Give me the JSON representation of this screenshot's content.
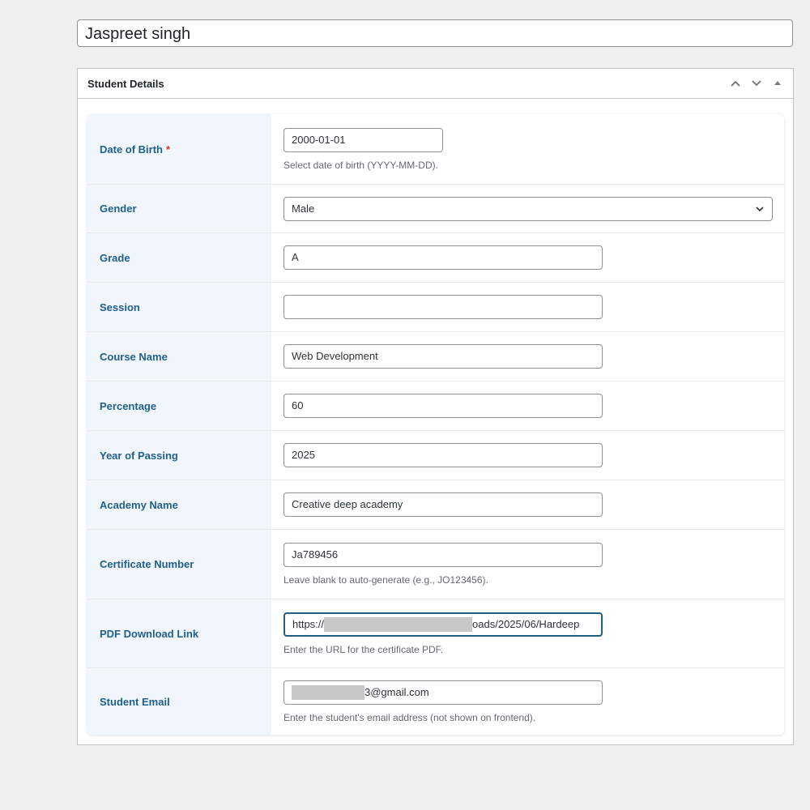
{
  "post_title": "Jaspreet singh",
  "metabox": {
    "title": "Student Details"
  },
  "fields": {
    "dob": {
      "label": "Date of Birth",
      "required_mark": "*",
      "value": "2000-01-01",
      "description": "Select date of birth (YYYY-MM-DD)."
    },
    "gender": {
      "label": "Gender",
      "value": "Male"
    },
    "grade": {
      "label": "Grade",
      "value": "A"
    },
    "session": {
      "label": "Session",
      "value": ""
    },
    "course": {
      "label": "Course Name",
      "value": "Web Development"
    },
    "percentage": {
      "label": "Percentage",
      "value": "60"
    },
    "year": {
      "label": "Year of Passing",
      "value": "2025"
    },
    "academy": {
      "label": "Academy Name",
      "value": "Creative deep academy"
    },
    "certificate": {
      "label": "Certificate Number",
      "value": "Ja789456",
      "description": "Leave blank to auto-generate (e.g., JO123456)."
    },
    "pdf": {
      "label": "PDF Download Link",
      "value_prefix": "https://",
      "value_suffix": "oads/2025/06/Hardeep",
      "description": "Enter the URL for the certificate PDF."
    },
    "email": {
      "label": "Student Email",
      "value_suffix": "3@gmail.com",
      "description": "Enter the student's email address (not shown on frontend)."
    }
  }
}
